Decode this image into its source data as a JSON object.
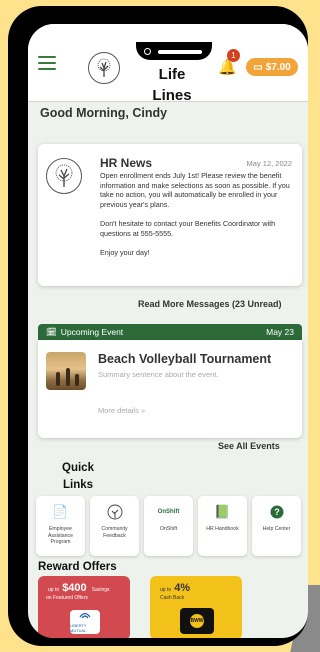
{
  "app": {
    "title": "Life Lines",
    "notification_count": "1",
    "balance": "$7.00"
  },
  "greeting": "Good Morning, Cindy",
  "hr_news": {
    "title": "HR News",
    "date": "May 12, 2022",
    "paragraphs": [
      "Open enrollment ends July 1st! Please review the benefit information and make selections as soon as possible. If you take no action, you will automatically be enrolled in your previous year's plans.",
      "Don't hesitate to contact your Benefits Coordinator with questions at 555-5555.",
      "Enjoy your day!"
    ]
  },
  "read_more": "Read More Messages (23 Unread)",
  "event": {
    "header_label": "Upcoming Event",
    "header_date": "May 23",
    "title": "Beach Volleyball Tournament",
    "summary": "Summary sentence about the event.",
    "more": "More details »"
  },
  "see_all_events": "See All Events",
  "quick_links": {
    "title": "Quick Links",
    "items": [
      {
        "label": "Employee Assistance Program",
        "icon": "document-icon"
      },
      {
        "label": "Community Feedback",
        "icon": "tree-logo-icon"
      },
      {
        "label": "OnShift",
        "icon": "onshift-logo-icon",
        "logo_text": "OnShift"
      },
      {
        "label": "HR Handbook",
        "icon": "handbook-icon"
      },
      {
        "label": "Help Center",
        "icon": "help-icon"
      }
    ]
  },
  "reward_offers": {
    "title": "Reward Offers",
    "items": [
      {
        "prefix": "up to",
        "amount": "$400",
        "amount_suffix": "Savings",
        "subtitle": "on Featured Offers",
        "brand": "LIBERTY MUTUAL",
        "color": "#d2494f"
      },
      {
        "prefix": "up to",
        "amount": "4%",
        "subtitle": "Cash Back",
        "brand": "BUFFALO WILD WINGS",
        "color": "#f2c21a"
      }
    ]
  },
  "colors": {
    "accent_green": "#2d6a3a",
    "accent_orange": "#f2a43a",
    "badge_red": "#d6401f",
    "background_yellow": "#ffe38c"
  }
}
